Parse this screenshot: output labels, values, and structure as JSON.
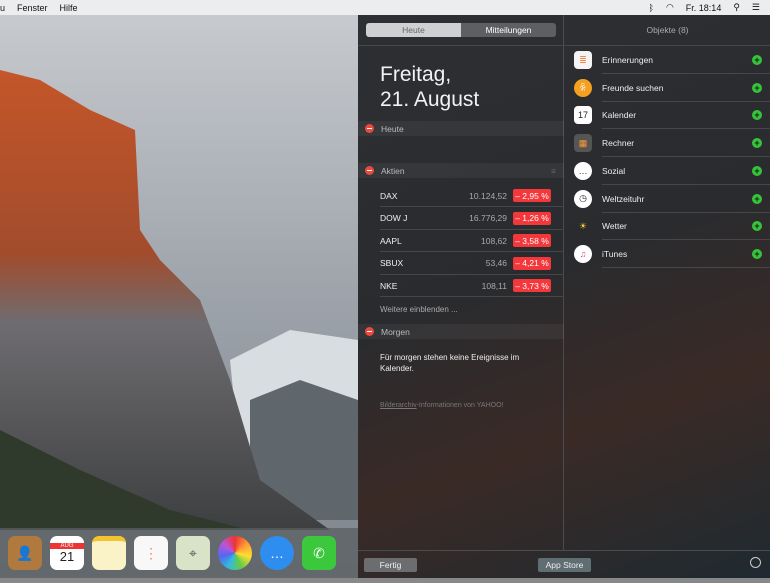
{
  "menubar": {
    "items": [
      "u",
      "Fenster",
      "Hilfe"
    ],
    "clock": "Fr. 18:14"
  },
  "tabs": {
    "today": "Heute",
    "notifications": "Mitteilungen"
  },
  "date": {
    "line1": "Freitag,",
    "line2": "21. August"
  },
  "sections": {
    "today": "Heute",
    "stocks": "Aktien",
    "tomorrow": "Morgen"
  },
  "stocks": [
    {
      "symbol": "DAX",
      "value": "10.124,52",
      "change": "– 2,95 %"
    },
    {
      "symbol": "DOW J",
      "value": "16.776,29",
      "change": "– 1,26 %"
    },
    {
      "symbol": "AAPL",
      "value": "108,62",
      "change": "– 3,58 %"
    },
    {
      "symbol": "SBUX",
      "value": "53,46",
      "change": "– 4,21 %"
    },
    {
      "symbol": "NKE",
      "value": "108,11",
      "change": "– 3,73 %"
    }
  ],
  "show_more": "Weitere einblenden ...",
  "tomorrow_text": "Für morgen stehen keine Ereignisse im Kalender.",
  "credit": {
    "link": "Bilderarchiv",
    "text": "-Informationen von YAHOO!"
  },
  "objects": {
    "header": "Objekte (8)",
    "items": [
      {
        "label": "Erinnerungen",
        "icon": "reminders-icon"
      },
      {
        "label": "Freunde suchen",
        "icon": "find-friends-icon"
      },
      {
        "label": "Kalender",
        "icon": "calendar-icon"
      },
      {
        "label": "Rechner",
        "icon": "calculator-icon"
      },
      {
        "label": "Sozial",
        "icon": "social-icon"
      },
      {
        "label": "Weltzeituhr",
        "icon": "world-clock-icon"
      },
      {
        "label": "Wetter",
        "icon": "weather-icon"
      },
      {
        "label": "iTunes",
        "icon": "itunes-icon"
      }
    ]
  },
  "footer": {
    "done": "Fertig",
    "app_store": "App Store"
  },
  "dock": {
    "calendar_month": "AUG",
    "calendar_day": "21"
  }
}
